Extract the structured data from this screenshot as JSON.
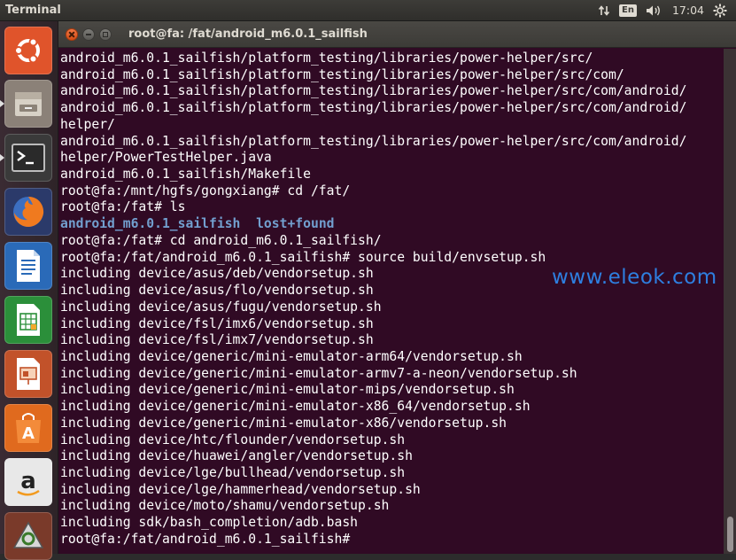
{
  "top_panel": {
    "app_title": "Terminal",
    "keyboard_layout": "En",
    "clock": "17:04",
    "icons": [
      "network-updown-icon",
      "keyboard-layout-icon",
      "volume-icon",
      "gear-icon"
    ]
  },
  "launcher": {
    "items": [
      {
        "name": "ubuntu-dash-icon",
        "bg": "#e0542b"
      },
      {
        "name": "files-icon",
        "bg": "#8b8178"
      },
      {
        "name": "terminal-icon",
        "bg": "#3a3a3a"
      },
      {
        "name": "firefox-icon",
        "bg": "#d9571c"
      },
      {
        "name": "libreoffice-writer-icon",
        "bg": "#2a6ab8"
      },
      {
        "name": "libreoffice-calc-icon",
        "bg": "#2b8f3a"
      },
      {
        "name": "libreoffice-impress-icon",
        "bg": "#c2522a"
      },
      {
        "name": "software-center-icon",
        "bg": "#e06a1e"
      },
      {
        "name": "amazon-icon",
        "bg": "#cfcfcf"
      },
      {
        "name": "system-updater-icon",
        "bg": "#7a3a2a"
      }
    ]
  },
  "window": {
    "title": "root@fa: /fat/android_m6.0.1_sailfish"
  },
  "terminal": {
    "lines": [
      "android_m6.0.1_sailfish/platform_testing/libraries/power-helper/src/",
      "android_m6.0.1_sailfish/platform_testing/libraries/power-helper/src/com/",
      "android_m6.0.1_sailfish/platform_testing/libraries/power-helper/src/com/android/",
      "android_m6.0.1_sailfish/platform_testing/libraries/power-helper/src/com/android/",
      "helper/",
      "android_m6.0.1_sailfish/platform_testing/libraries/power-helper/src/com/android/",
      "helper/PowerTestHelper.java",
      "android_m6.0.1_sailfish/Makefile",
      "root@fa:/mnt/hgfs/gongxiang# cd /fat/",
      "root@fa:/fat# ls",
      "",
      "root@fa:/fat# cd android_m6.0.1_sailfish/",
      "root@fa:/fat/android_m6.0.1_sailfish# source build/envsetup.sh",
      "including device/asus/deb/vendorsetup.sh",
      "including device/asus/flo/vendorsetup.sh",
      "including device/asus/fugu/vendorsetup.sh",
      "including device/fsl/imx6/vendorsetup.sh",
      "including device/fsl/imx7/vendorsetup.sh",
      "including device/generic/mini-emulator-arm64/vendorsetup.sh",
      "including device/generic/mini-emulator-armv7-a-neon/vendorsetup.sh",
      "including device/generic/mini-emulator-mips/vendorsetup.sh",
      "including device/generic/mini-emulator-x86_64/vendorsetup.sh",
      "including device/generic/mini-emulator-x86/vendorsetup.sh",
      "including device/htc/flounder/vendorsetup.sh",
      "including device/huawei/angler/vendorsetup.sh",
      "including device/lge/bullhead/vendorsetup.sh",
      "including device/lge/hammerhead/vendorsetup.sh",
      "including device/moto/shamu/vendorsetup.sh",
      "including sdk/bash_completion/adb.bash",
      "root@fa:/fat/android_m6.0.1_sailfish# "
    ],
    "ls_output": [
      "android_m6.0.1_sailfish",
      "lost+found"
    ],
    "dir_color": "#729fcf",
    "text_color": "#ffffff",
    "background": "#300a24"
  },
  "watermark": "www.eleok.com"
}
